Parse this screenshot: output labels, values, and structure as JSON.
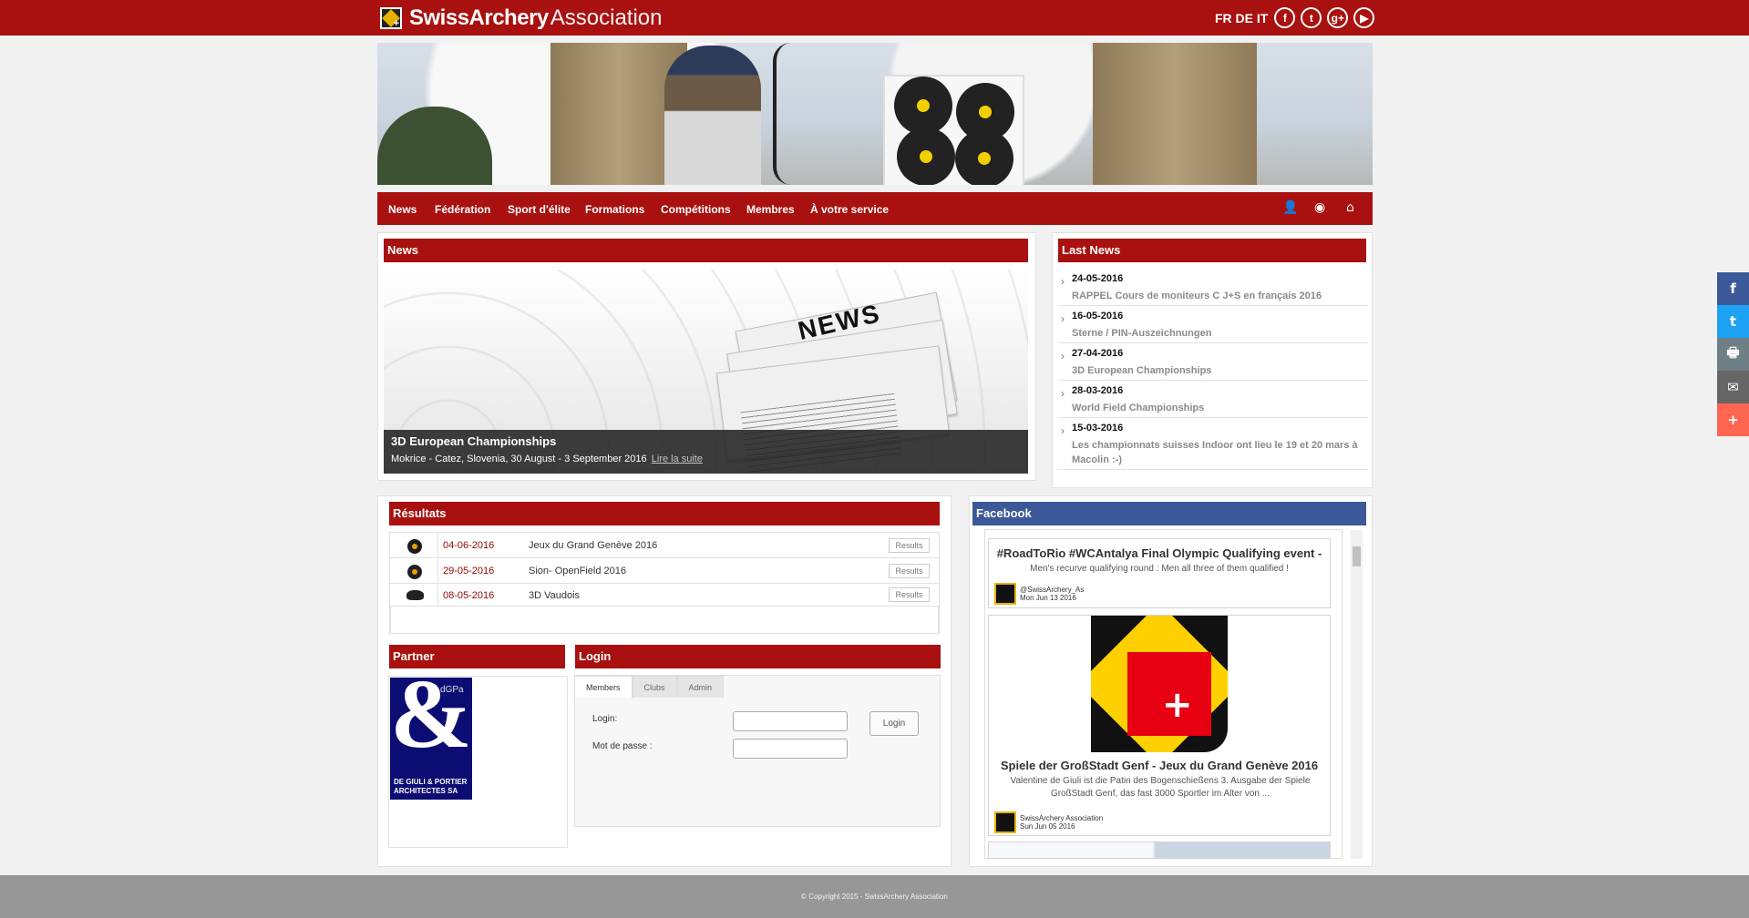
{
  "header": {
    "brand_strong": "SwissArchery",
    "brand_light": "Association",
    "languages": "FR DE IT",
    "social": [
      "facebook-icon",
      "twitter-icon",
      "google-plus-icon",
      "youtube-icon"
    ]
  },
  "nav": {
    "items": [
      "News",
      "Fédération",
      "Sport d'élite",
      "Formations",
      "Compétitions",
      "Membres",
      "À votre service"
    ],
    "icons": [
      "user-icon",
      "globe-icon",
      "home-icon"
    ]
  },
  "news": {
    "title": "News",
    "image_word": "NEWS",
    "featured_title": "3D European Championships",
    "featured_text": "Mokrice - Catez, Slovenia, 30 August - 3 September 2016",
    "readmore": "Lire la suite"
  },
  "last_news": {
    "title": "Last News",
    "items": [
      {
        "date": "24-05-2016",
        "title": "RAPPEL Cours de moniteurs C J+S en français 2016"
      },
      {
        "date": "16-05-2016",
        "title": "Sterne / PIN-Auszeichnungen"
      },
      {
        "date": "27-04-2016",
        "title": "3D European Championships"
      },
      {
        "date": "28-03-2016",
        "title": "World Field Championships"
      },
      {
        "date": "15-03-2016",
        "title": "Les championnats suisses Indoor ont lieu le 19 et 20 mars à Macolin :-)"
      }
    ]
  },
  "results": {
    "title": "Résultats",
    "rows": [
      {
        "date": "04-06-2016",
        "event": "Jeux du Grand Genève 2016",
        "button": "Results",
        "icon": "target-icon"
      },
      {
        "date": "29-05-2016",
        "event": "Sion- OpenField 2016",
        "button": "Results",
        "icon": "target-icon"
      },
      {
        "date": "08-05-2016",
        "event": "3D Vaudois",
        "button": "Results",
        "icon": "animal-target-icon"
      }
    ]
  },
  "partner": {
    "title": "Partner",
    "logo_top": "dGPa",
    "logo_bottom_1": "DE GIULI & PORTIER",
    "logo_bottom_2": "ARCHITECTES SA"
  },
  "login": {
    "title": "Login",
    "tabs": [
      "Members",
      "Clubs",
      "Admin"
    ],
    "login_label": "Login:",
    "password_label": "Mot de passe :",
    "button": "Login",
    "login_value": "",
    "password_value": ""
  },
  "facebook": {
    "title": "Facebook",
    "posts": [
      {
        "title": "#RoadToRio #WCAntalya Final Olympic Qualifying event -",
        "text": "Men's recurve qualifying round : Men all three of them qualified !",
        "author": "@SwissArchery_As",
        "date": "Mon Jun 13 2016"
      },
      {
        "title": "Spiele der GroßStadt Genf - Jeux du Grand Genève 2016",
        "text": "Valentine de Giuli ist die Patin des Bogenschießens 3. Ausgabe der Spiele GroßStadt Genf, das fast 3000 Sportler im Alter von ...",
        "author": "SwissArchery Association",
        "date": "Sun Jun 05 2016"
      }
    ]
  },
  "share_buttons": [
    {
      "label": "f",
      "color": "#3b5998"
    },
    {
      "label": "t",
      "color": "#1da1f2"
    },
    {
      "label": "🖶",
      "color": "#6e7f86"
    },
    {
      "label": "✉",
      "color": "#666666"
    },
    {
      "label": "+",
      "color": "#ff6550"
    }
  ],
  "footer": {
    "copyright": "© Copyright 2015 - SwissArchery Association"
  }
}
